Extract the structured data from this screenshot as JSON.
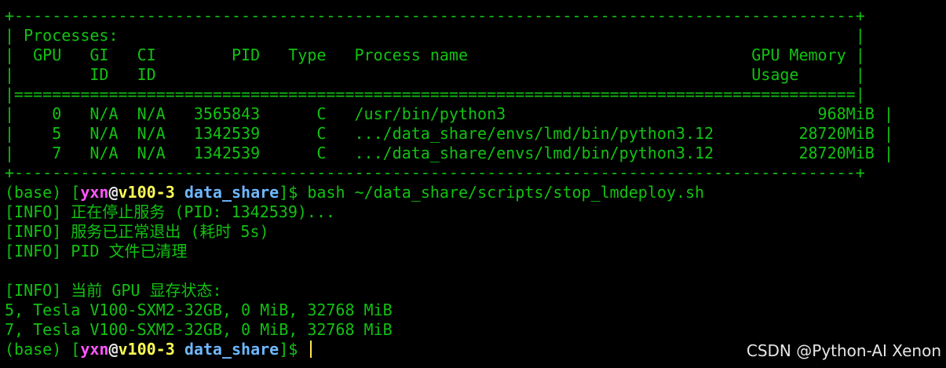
{
  "table": {
    "border_top": "+-----------------------------------------------------------------------------------------+",
    "title_row": "| Processes:                                                                              |",
    "header_row1": "|  GPU   GI   CI        PID   Type   Process name                              GPU Memory |",
    "header_row2": "|        ID   ID                                                               Usage      |",
    "separator": "|=========================================================================================|",
    "rows": [
      "|    0   N/A  N/A   3565843      C   /usr/bin/python3                                 968MiB |",
      "|    5   N/A  N/A   1342539      C   .../data_share/envs/lmd/bin/python3.12         28720MiB |",
      "|    7   N/A  N/A   1342539      C   .../data_share/envs/lmd/bin/python3.12         28720MiB |"
    ],
    "border_bottom": "+-----------------------------------------------------------------------------------------+"
  },
  "prompt": {
    "env": "(base) ",
    "open_bracket": "[",
    "user": "yxn",
    "at": "@",
    "host": "v100-3",
    "space": " ",
    "dir": "data_share",
    "close": "]$ "
  },
  "command": "bash ~/data_share/scripts/stop_lmdeploy.sh",
  "output": [
    "[INFO] 正在停止服务 (PID: 1342539)...",
    "[INFO] 服务已正常退出 (耗时 5s)",
    "[INFO] PID 文件已清理",
    "",
    "[INFO] 当前 GPU 显存状态:",
    "5, Tesla V100-SXM2-32GB, 0 MiB, 32768 MiB",
    "7, Tesla V100-SXM2-32GB, 0 MiB, 32768 MiB"
  ],
  "watermark": "CSDN @Python-AI Xenon",
  "colors": {
    "text": "#12c112",
    "user": "#ff55ff",
    "host": "#ffff55",
    "dir": "#6fb8ff",
    "background": "#000000"
  }
}
